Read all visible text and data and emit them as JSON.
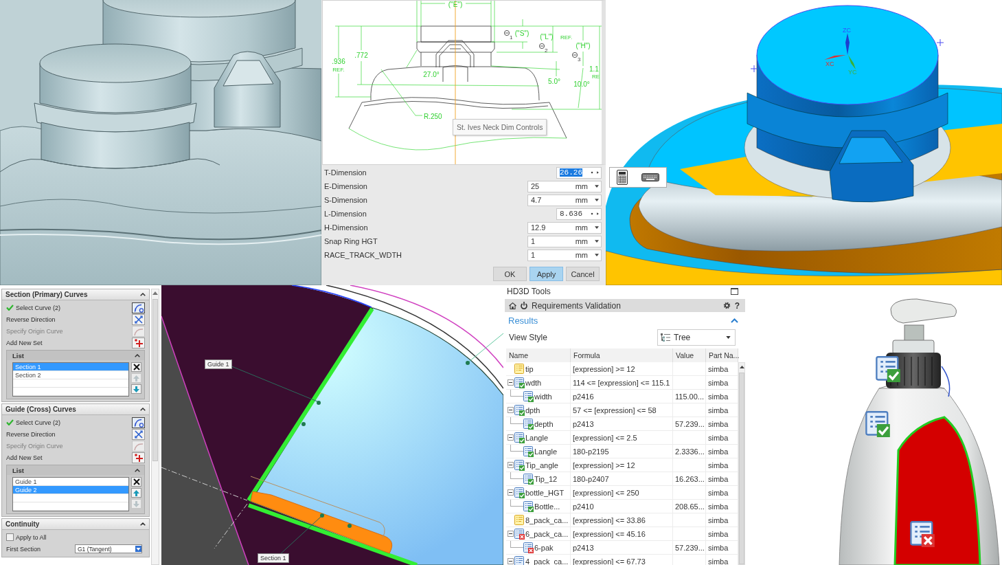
{
  "neck_drawing": {
    "dimension_labels": [
      "(\"E\")",
      "(\"S\")",
      "(\"L\")",
      "REF.",
      "(\"H\")",
      ".936",
      "REF.",
      ".772",
      "27.0°",
      "5.0°",
      "10.0°",
      "1.1",
      "RE",
      "R.250"
    ],
    "datum_labels": [
      "1",
      "2",
      "3"
    ],
    "tooltip": "St. Ives Neck Dim Controls"
  },
  "dimension_dialog": {
    "fields": [
      {
        "label": "T-Dimension",
        "kind": "expression",
        "value": "26.26",
        "highlighted": true
      },
      {
        "label": "E-Dimension",
        "kind": "unit",
        "value": "25",
        "unit": "mm",
        "highlighted": false
      },
      {
        "label": "S-Dimension",
        "kind": "unit",
        "value": "4.7",
        "unit": "mm",
        "highlighted": false
      },
      {
        "label": "L-Dimension",
        "kind": "expression",
        "value": "8.636",
        "highlighted": false
      },
      {
        "label": "H-Dimension",
        "kind": "unit",
        "value": "12.9",
        "unit": "mm",
        "highlighted": false
      },
      {
        "label": "Snap Ring HGT",
        "kind": "unit",
        "value": "1",
        "unit": "mm",
        "highlighted": false
      },
      {
        "label": "RACE_TRACK_WDTH",
        "kind": "unit",
        "value": "1",
        "unit": "mm",
        "highlighted": false
      }
    ],
    "buttons": [
      {
        "label": "OK",
        "default": false
      },
      {
        "label": "Apply",
        "default": true
      },
      {
        "label": "Cancel",
        "default": false
      }
    ]
  },
  "model_view": {
    "axis_labels": [
      "ZC",
      "XC",
      "YC"
    ]
  },
  "sweep_panel": {
    "sections": [
      {
        "title": "Section (Primary) Curves",
        "expanded": true,
        "rows": [
          {
            "kind": "select",
            "label": "Select Curve (2)",
            "done": true
          },
          {
            "kind": "reverse",
            "label": "Reverse Direction",
            "disabled": false
          },
          {
            "kind": "origin",
            "label": "Specify Origin Curve",
            "disabled": true
          },
          {
            "kind": "add_set",
            "label": "Add New Set",
            "disabled": false
          }
        ],
        "list": {
          "title": "List",
          "expanded": true,
          "items": [
            {
              "label": "Section 1",
              "selected": true
            },
            {
              "label": "Section 2",
              "selected": false
            }
          ],
          "buttons": [
            {
              "kind": "remove",
              "disabled": false
            },
            {
              "kind": "up",
              "disabled": true
            },
            {
              "kind": "down",
              "disabled": false
            }
          ]
        }
      },
      {
        "title": "Guide (Cross) Curves",
        "expanded": true,
        "rows": [
          {
            "kind": "select",
            "label": "Select Curve (2)",
            "done": true
          },
          {
            "kind": "reverse",
            "label": "Reverse Direction",
            "disabled": false
          },
          {
            "kind": "origin",
            "label": "Specify Origin Curve",
            "disabled": true
          },
          {
            "kind": "add_set",
            "label": "Add New Set",
            "disabled": false
          }
        ],
        "list": {
          "title": "List",
          "expanded": true,
          "items": [
            {
              "label": "Guide 1",
              "selected": false
            },
            {
              "label": "Guide 2",
              "selected": true
            }
          ],
          "buttons": [
            {
              "kind": "remove",
              "disabled": false
            },
            {
              "kind": "up",
              "disabled": false
            },
            {
              "kind": "down",
              "disabled": true
            }
          ]
        }
      },
      {
        "title": "Continuity",
        "expanded": true,
        "rows": [
          {
            "kind": "checkbox",
            "label": "Apply to All",
            "checked": false
          },
          {
            "kind": "dropdown",
            "label": "First Section",
            "value": "G1 (Tangent)"
          }
        ]
      }
    ]
  },
  "curve_view": {
    "callouts": [
      "Guide 1",
      "Section 1"
    ]
  },
  "hd3d_tools": {
    "title": "HD3D Tools",
    "tool": "Requirements Validation",
    "help": "?",
    "results": {
      "title": "Results",
      "expanded": true
    },
    "view_style": {
      "label": "View Style",
      "value": "Tree"
    },
    "columns": [
      "Name",
      "Formula",
      "Value",
      "Part Na..."
    ],
    "rows": [
      {
        "name": "tip",
        "kind": "pending",
        "formula": "[expression] >= 12",
        "part": "simba"
      },
      {
        "name": "wdth",
        "kind": "pass",
        "formula": "114 <= [expression] <= 115.1",
        "part": "simba",
        "expanded": true,
        "children": [
          {
            "name": "width",
            "kind": "pass",
            "formula": "p2416",
            "value": "115.00...",
            "part": "simba"
          }
        ]
      },
      {
        "name": "dpth",
        "kind": "pass",
        "formula": "57 <= [expression] <= 58",
        "part": "simba",
        "expanded": true,
        "children": [
          {
            "name": "depth",
            "kind": "pass",
            "formula": "p2413",
            "value": "57.239...",
            "part": "simba"
          }
        ]
      },
      {
        "name": "Langle",
        "kind": "pass",
        "formula": "[expression] <= 2.5",
        "part": "simba",
        "expanded": true,
        "children": [
          {
            "name": "Langle",
            "kind": "pass",
            "formula": "180-p2195",
            "value": "2.3336...",
            "part": "simba"
          }
        ]
      },
      {
        "name": "Tip_angle",
        "kind": "pass",
        "formula": "[expression] >= 12",
        "part": "simba",
        "expanded": true,
        "children": [
          {
            "name": "Tip_12",
            "kind": "pass",
            "formula": "180-p2407",
            "value": "16.263...",
            "part": "simba"
          }
        ]
      },
      {
        "name": "bottle_HGT",
        "kind": "pass",
        "formula": "[expression] <= 250",
        "part": "simba",
        "expanded": true,
        "children": [
          {
            "name": "Bottle...",
            "kind": "pass",
            "formula": "p2410",
            "value": "208.65...",
            "part": "simba"
          }
        ]
      },
      {
        "name": "8_pack_ca...",
        "kind": "pending",
        "formula": "[expression] <= 33.86",
        "part": "simba"
      },
      {
        "name": "6_pack_ca...",
        "kind": "fail",
        "formula": "[expression] <= 45.16",
        "part": "simba",
        "expanded": true,
        "children": [
          {
            "name": "6-pak",
            "kind": "fail",
            "formula": "p2413",
            "value": "57.239...",
            "part": "simba"
          }
        ]
      },
      {
        "name": "4_pack_ca...",
        "formula": "[expression] <= 67.73",
        "part": "simba",
        "expanded": true
      }
    ]
  }
}
